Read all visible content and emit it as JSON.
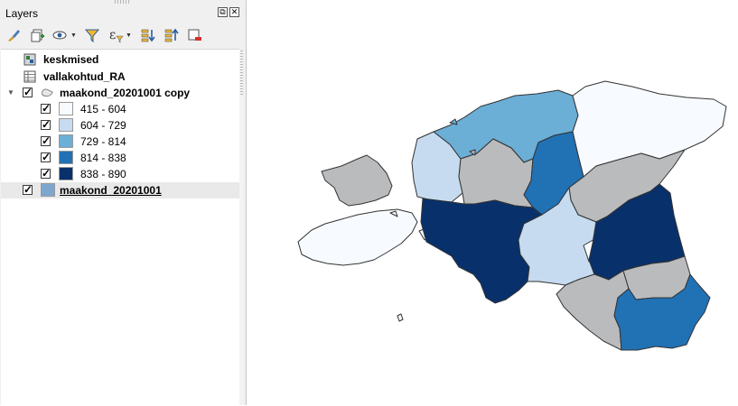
{
  "panel": {
    "title": "Layers",
    "float_label": "⧉",
    "close_label": "✕",
    "toolbar": [
      {
        "icon": "paintbrush-icon",
        "label": "Open Layer Styling Panel"
      },
      {
        "icon": "add-group-icon",
        "label": "Add Group"
      },
      {
        "icon": "eye-icon",
        "label": "Manage Map Themes"
      },
      {
        "icon": "filter-icon",
        "label": "Filter Legend"
      },
      {
        "icon": "expression-filter-icon",
        "label": "Filter Legend by Expression"
      },
      {
        "icon": "expand-all-icon",
        "label": "Expand All"
      },
      {
        "icon": "collapse-all-icon",
        "label": "Collapse All"
      },
      {
        "icon": "remove-layer-icon",
        "label": "Remove Layer/Group"
      }
    ]
  },
  "layers": [
    {
      "name": "keskmised",
      "checked": false,
      "type": "raster"
    },
    {
      "name": "vallakohtud_RA",
      "checked": false,
      "type": "table"
    },
    {
      "name": "maakond_20201001 copy",
      "checked": true,
      "type": "polygon",
      "expanded": true,
      "classes": [
        {
          "label": "415 - 604",
          "color": "#f7fbff",
          "checked": true
        },
        {
          "label": "604 - 729",
          "color": "#c6dbef",
          "checked": true
        },
        {
          "label": "729 - 814",
          "color": "#6baed6",
          "checked": true
        },
        {
          "label": "814 - 838",
          "color": "#2171b5",
          "checked": true
        },
        {
          "label": "838 - 890",
          "color": "#08306b",
          "checked": true
        }
      ]
    },
    {
      "name": "maakond_20201001",
      "checked": true,
      "type": "polygon",
      "color": "#7ea6cf",
      "selected": true
    }
  ],
  "map": {
    "colors": {
      "c415": "#f7fbff",
      "c604": "#c6dbef",
      "c729": "#6baed6",
      "c814": "#2171b5",
      "c838": "#08306b",
      "nodata": "#babbbd"
    }
  }
}
